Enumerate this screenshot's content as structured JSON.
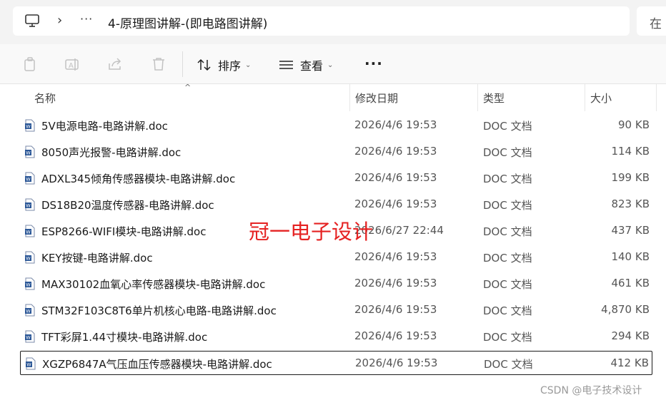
{
  "address_bar": {
    "computer_icon": "computer-icon",
    "chevron": "›",
    "overflow": "···",
    "path": "4-原理图讲解-(即电路图讲解)"
  },
  "search": {
    "text": "在"
  },
  "toolbar": {
    "copy_icon": "copy-icon",
    "rename_icon": "rename-icon",
    "share_icon": "share-icon",
    "delete_icon": "delete-icon",
    "sort_label": "排序",
    "view_label": "查看",
    "more_label": "···"
  },
  "columns": {
    "name": "名称",
    "modified": "修改日期",
    "type": "类型",
    "size": "大小"
  },
  "files": [
    {
      "name": "5V电源电路-电路讲解.doc",
      "modified": "2026/4/6 19:53",
      "type": "DOC 文档",
      "size": "90 KB"
    },
    {
      "name": "8050声光报警-电路讲解.doc",
      "modified": "2026/4/6 19:53",
      "type": "DOC 文档",
      "size": "114 KB"
    },
    {
      "name": "ADXL345倾角传感器模块-电路讲解.doc",
      "modified": "2026/4/6 19:53",
      "type": "DOC 文档",
      "size": "199 KB"
    },
    {
      "name": "DS18B20温度传感器-电路讲解.doc",
      "modified": "2026/4/6 19:53",
      "type": "DOC 文档",
      "size": "823 KB"
    },
    {
      "name": "ESP8266-WIFI模块-电路讲解.doc",
      "modified": "2026/6/27 22:44",
      "type": "DOC 文档",
      "size": "437 KB"
    },
    {
      "name": "KEY按键-电路讲解.doc",
      "modified": "2026/4/6 19:53",
      "type": "DOC 文档",
      "size": "140 KB"
    },
    {
      "name": "MAX30102血氧心率传感器模块-电路讲解.doc",
      "modified": "2026/4/6 19:53",
      "type": "DOC 文档",
      "size": "461 KB"
    },
    {
      "name": "STM32F103C8T6单片机核心电路-电路讲解.doc",
      "modified": "2026/4/6 19:53",
      "type": "DOC 文档",
      "size": "4,870 KB"
    },
    {
      "name": "TFT彩屏1.44寸模块-电路讲解.doc",
      "modified": "2026/4/6 19:53",
      "type": "DOC 文档",
      "size": "294 KB"
    },
    {
      "name": "XGZP6847A气压血压传感器模块-电路讲解.doc",
      "modified": "2026/4/6 19:53",
      "type": "DOC 文档",
      "size": "412 KB"
    }
  ],
  "selected_index": 9,
  "overlay_text": "冠一电子设计",
  "watermark": "CSDN @电子技术设计",
  "colors": {
    "overlay": "#e52222",
    "word_icon": "#2b5797"
  }
}
